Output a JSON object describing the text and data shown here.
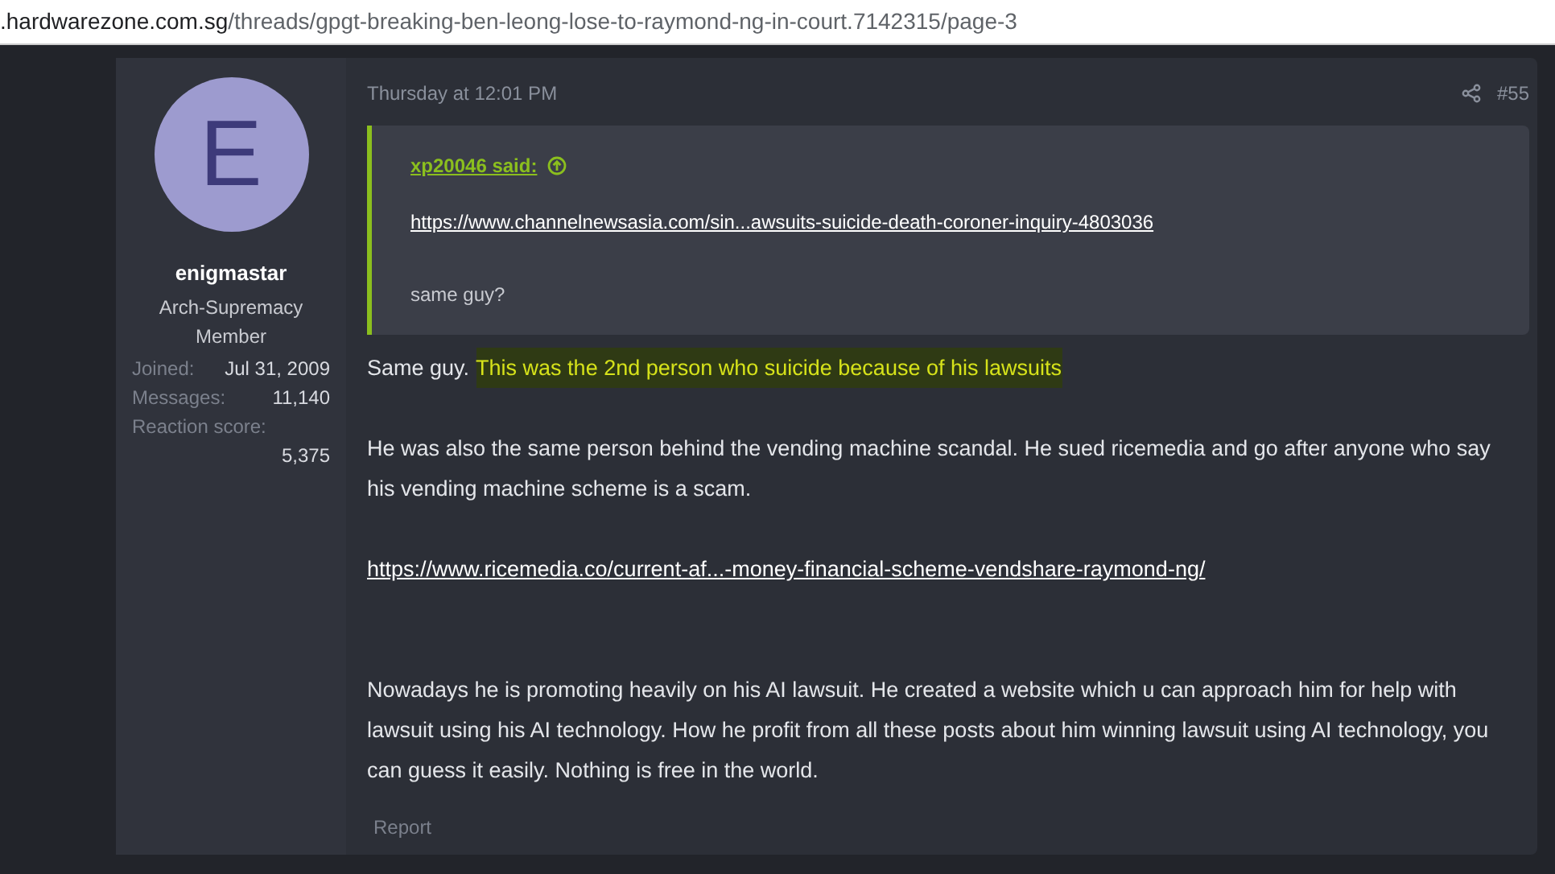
{
  "address_bar": {
    "domain": ".hardwarezone.com.sg",
    "path": "/threads/gpgt-breaking-ben-leong-lose-to-raymond-ng-in-court.7142315/page-3"
  },
  "user": {
    "avatar_letter": "E",
    "name": "enigmastar",
    "title": "Arch-Supremacy Member",
    "stats": [
      {
        "label": "Joined:",
        "value": "Jul 31, 2009",
        "kind": "inline"
      },
      {
        "label": "Messages:",
        "value": "11,140",
        "kind": "inline"
      },
      {
        "label": "Reaction score:",
        "value": "5,375",
        "kind": "stacked"
      }
    ]
  },
  "post": {
    "time": "Thursday at 12:01 PM",
    "number": "#55",
    "quote": {
      "author": "xp20046 said:",
      "link": "https://www.channelnewsasia.com/sin...awsuits-suicide-death-coroner-inquiry-4803036",
      "text": "same guy?"
    },
    "paragraphs": [
      {
        "kind": "text",
        "text": "Same guy.",
        "highlight": "This was the 2nd person who suicide because of his lawsuits"
      },
      {
        "kind": "text",
        "text": "He was also the same person behind the vending machine scandal. He sued ricemedia and go after anyone who say his vending machine scheme is a scam."
      },
      {
        "kind": "link",
        "text": "https://www.ricemedia.co/current-af...-money-financial-scheme-vendshare-raymond-ng/"
      },
      {
        "kind": "text",
        "text": "Nowadays he is promoting heavily on his AI lawsuit. He created a website which u can approach him for help with lawsuit using his AI technology. How he profit from all these posts about him winning lawsuit using AI technology, you can guess it easily. Nothing is free in the world."
      }
    ],
    "report": "Report"
  }
}
